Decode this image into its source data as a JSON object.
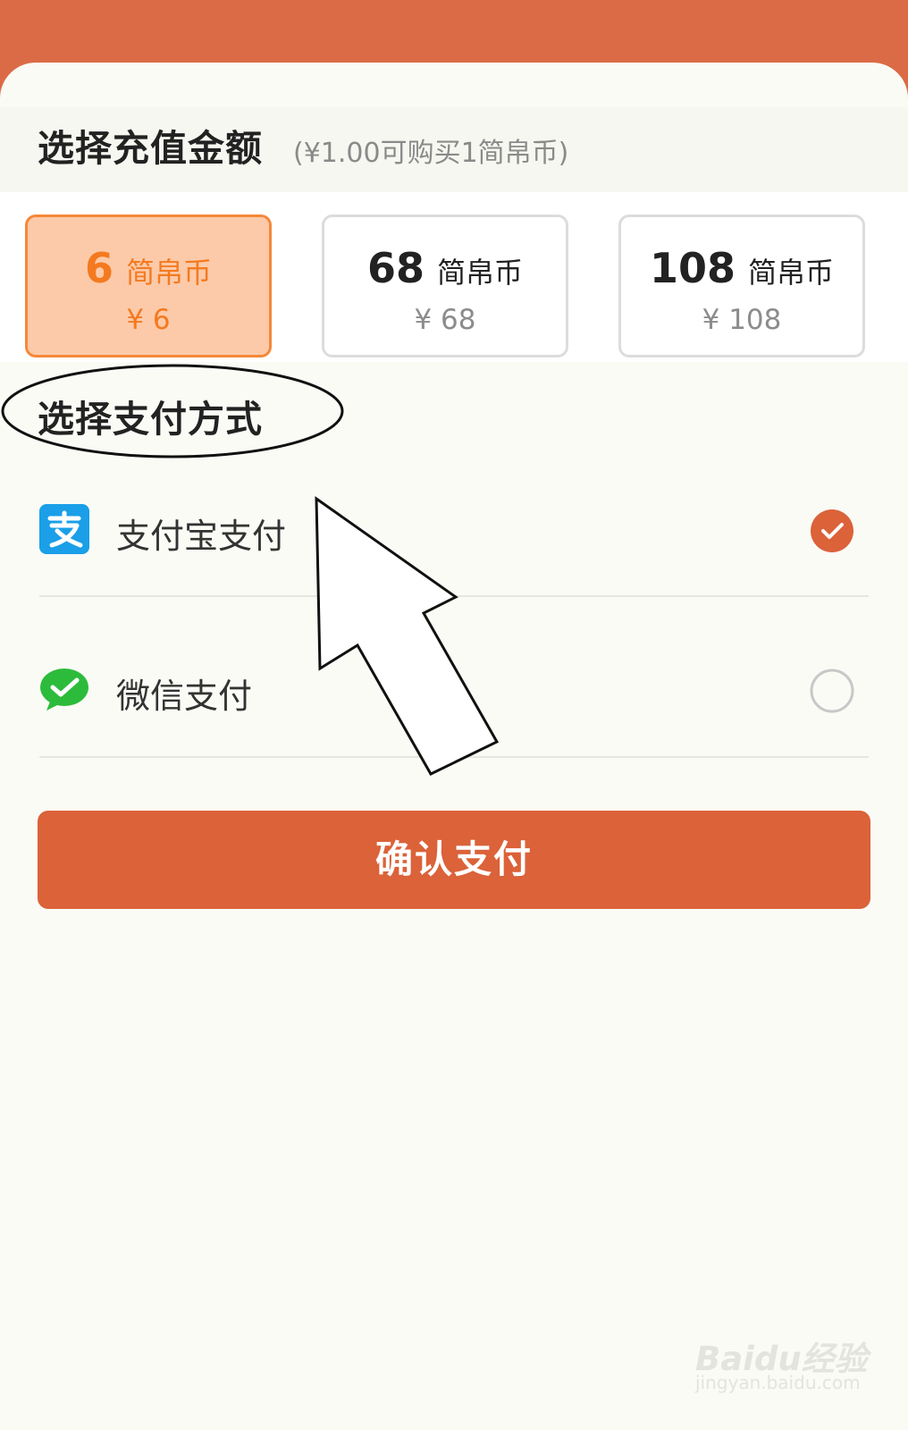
{
  "header": {
    "amount_title": "选择充值金额",
    "amount_note": "(¥1.00可购买1简帛币)"
  },
  "amount_options": [
    {
      "coins": "6",
      "unit": "简帛币",
      "price": "¥ 6",
      "selected": true
    },
    {
      "coins": "68",
      "unit": "简帛币",
      "price": "¥ 68",
      "selected": false
    },
    {
      "coins": "108",
      "unit": "简帛币",
      "price": "¥ 108",
      "selected": false
    }
  ],
  "payment": {
    "title": "选择支付方式",
    "methods": [
      {
        "label": "支付宝支付",
        "icon": "alipay-icon",
        "selected": true
      },
      {
        "label": "微信支付",
        "icon": "wechat-icon",
        "selected": false
      }
    ]
  },
  "confirm_label": "确认支付",
  "watermark": {
    "logo": "Baidu经验",
    "url": "jingyan.baidu.com"
  },
  "colors": {
    "brand": "#db6239",
    "header_bg": "#db6b46",
    "selected_option_bg": "#fccaa9",
    "selected_option_text": "#f47a20",
    "alipay_blue": "#1a9fe8",
    "wechat_green": "#2dbb3b"
  }
}
